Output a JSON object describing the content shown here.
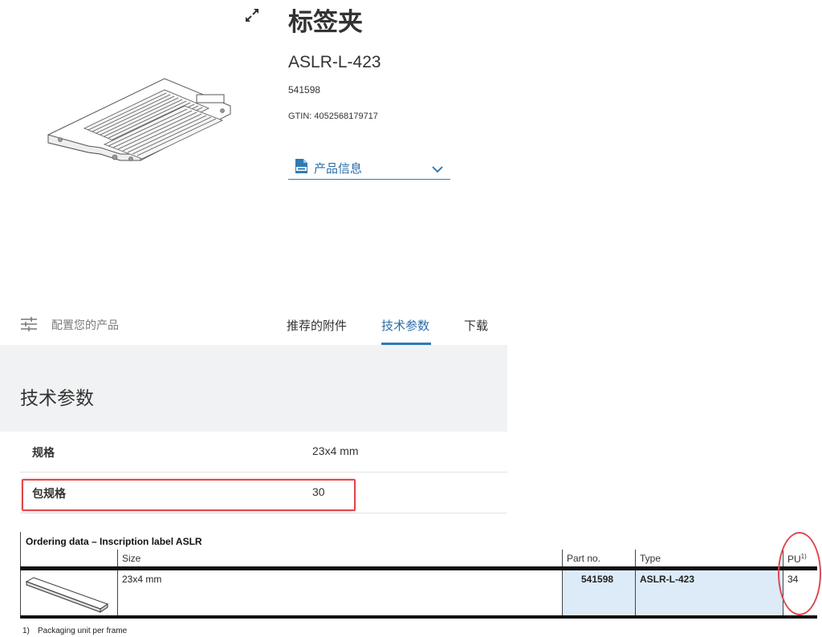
{
  "product": {
    "title": "标签夹",
    "type": "ASLR-L-423",
    "part_no": "541598",
    "gtin": "GTIN: 4052568179717",
    "info_dropdown_label": "产品信息"
  },
  "tabs": {
    "config_label": "配置您的产品",
    "accessories": "推荐的附件",
    "tech": "技术参数",
    "download": "下载"
  },
  "tech": {
    "heading": "技术参数",
    "rows": [
      {
        "key": "规格",
        "value": "23x4 mm"
      },
      {
        "key": "包规格",
        "value": "30"
      }
    ]
  },
  "ordering": {
    "title": "Ordering data – Inscription label ASLR",
    "headers": {
      "size": "Size",
      "part_no": "Part no.",
      "type": "Type",
      "pu": "PU",
      "pu_sup": "1)"
    },
    "row": {
      "size": "23x4 mm",
      "part_no": "541598",
      "type": "ASLR-L-423",
      "pu": "34"
    },
    "footnote_num": "1)",
    "footnote_text": "Packaging unit per frame"
  },
  "colors": {
    "accent": "#2f7ab4",
    "highlight": "#e0474c",
    "table_blue": "#dcebf7",
    "section_bg": "#f1f2f3"
  }
}
